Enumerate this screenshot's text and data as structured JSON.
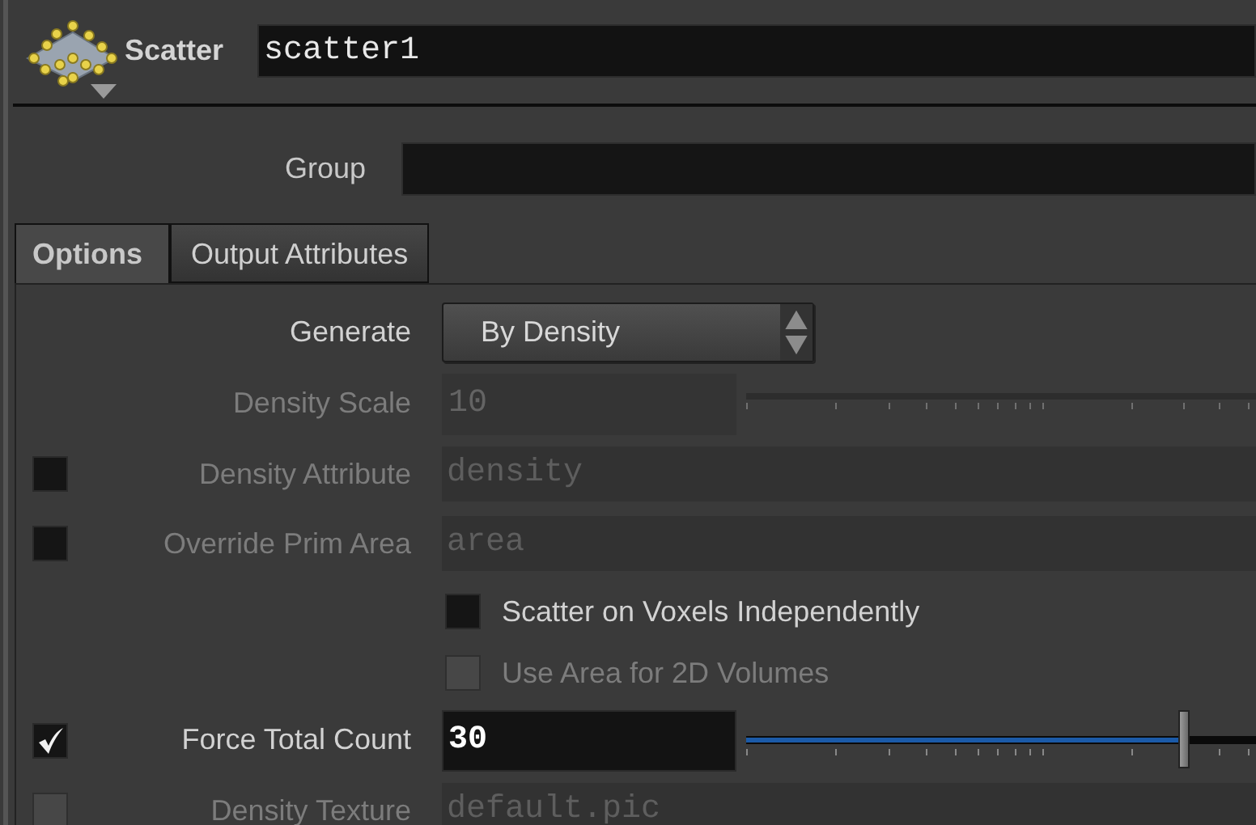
{
  "node": {
    "type_label": "Scatter",
    "name": "scatter1"
  },
  "group": {
    "label": "Group"
  },
  "tabs": [
    {
      "label": "Options",
      "selected": true
    },
    {
      "label": "Output Attributes",
      "selected": false
    }
  ],
  "parameters": [
    {
      "kind": "menu",
      "label": "Generate",
      "value": "By Density",
      "disabled": false
    },
    {
      "kind": "slider",
      "label": "Density Scale",
      "value": "10",
      "disabled": true
    },
    {
      "kind": "string",
      "label": "Density Attribute",
      "value": "density",
      "disabled": true,
      "toggle": {
        "checked": false,
        "disabled": false
      }
    },
    {
      "kind": "string",
      "label": "Override Prim Area",
      "value": "area",
      "disabled": true,
      "toggle": {
        "checked": false,
        "disabled": false
      }
    },
    {
      "kind": "toggle",
      "label": "Scatter on Voxels Independently",
      "checked": false,
      "disabled": false
    },
    {
      "kind": "toggle",
      "label": "Use Area for 2D Volumes",
      "checked": false,
      "disabled": true
    },
    {
      "kind": "slider",
      "label": "Force Total Count",
      "value": "30",
      "disabled": false,
      "level": 0.81,
      "toggle": {
        "checked": true,
        "disabled": false
      }
    },
    {
      "kind": "string",
      "label": "Density Texture",
      "value": "default.pic",
      "disabled": true,
      "toggle": {
        "checked": false,
        "disabled": true
      }
    }
  ]
}
